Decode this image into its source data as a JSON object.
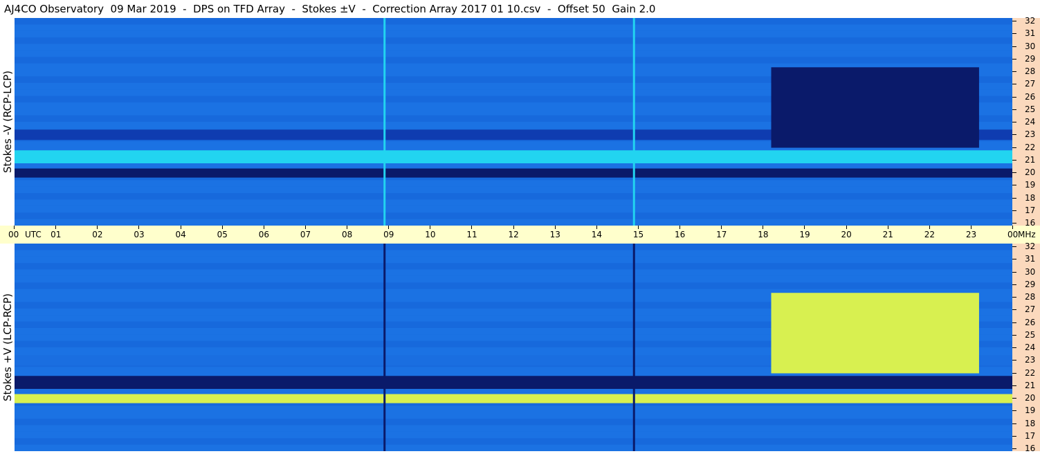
{
  "header": {
    "title": "AJ4CO Observatory  09 Mar 2019  -  DPS on TFD Array  -  Stokes ±V  -  Correction Array 2017 01 10.csv  -  Offset 50  Gain 2.0"
  },
  "panels": {
    "top": {
      "ylabel": "Stokes -V (RCP-LCP)"
    },
    "bottom": {
      "ylabel": "Stokes +V (LCP-RCP)"
    }
  },
  "time_axis": {
    "unit_label": "UTC",
    "end_unit": "MHz",
    "labels": [
      "00",
      "01",
      "02",
      "03",
      "04",
      "05",
      "06",
      "07",
      "08",
      "09",
      "10",
      "11",
      "12",
      "13",
      "14",
      "15",
      "16",
      "17",
      "18",
      "19",
      "20",
      "21",
      "22",
      "23",
      "00"
    ]
  },
  "freq_axis": {
    "labels": [
      "32",
      "31",
      "30",
      "29",
      "28",
      "27",
      "26",
      "25",
      "24",
      "23",
      "22",
      "21",
      "20",
      "19",
      "18",
      "17",
      "16"
    ]
  },
  "colors": {
    "background": "#1a6ee0",
    "deep": "#0a1a6a",
    "bright": "#22d4f0",
    "yellow": "#d8f050",
    "freq_axis_bg": "#fbd9bd",
    "time_axis_bg": "#ffffcc"
  },
  "chart_data": [
    {
      "type": "heatmap",
      "title": "Stokes -V (RCP-LCP)",
      "xlabel": "UTC",
      "ylabel": "MHz",
      "xlim": [
        0,
        24
      ],
      "ylim": [
        16,
        32
      ],
      "bands": [
        {
          "from": 19.7,
          "to": 20.4,
          "level": -2
        },
        {
          "from": 20.8,
          "to": 21.8,
          "level": 1
        },
        {
          "from": 22.6,
          "to": 23.4,
          "level": -1
        }
      ],
      "regions": [
        {
          "t0": 18.2,
          "t1": 23.2,
          "f0": 22.0,
          "f1": 28.2,
          "level": -2
        }
      ],
      "vlines": [
        {
          "t": 8.9,
          "level": 1
        },
        {
          "t": 14.9,
          "level": 1
        }
      ]
    },
    {
      "type": "heatmap",
      "title": "Stokes +V (LCP-RCP)",
      "xlabel": "UTC",
      "ylabel": "MHz",
      "xlim": [
        0,
        24
      ],
      "ylim": [
        16,
        32
      ],
      "bands": [
        {
          "from": 19.7,
          "to": 20.4,
          "level": 2
        },
        {
          "from": 20.8,
          "to": 21.8,
          "level": -2
        },
        {
          "from": 22.6,
          "to": 23.4,
          "level": 0
        }
      ],
      "regions": [
        {
          "t0": 18.2,
          "t1": 23.2,
          "f0": 22.0,
          "f1": 28.2,
          "level": 2
        }
      ],
      "vlines": [
        {
          "t": 8.9,
          "level": -2
        },
        {
          "t": 14.9,
          "level": -2
        }
      ]
    }
  ]
}
